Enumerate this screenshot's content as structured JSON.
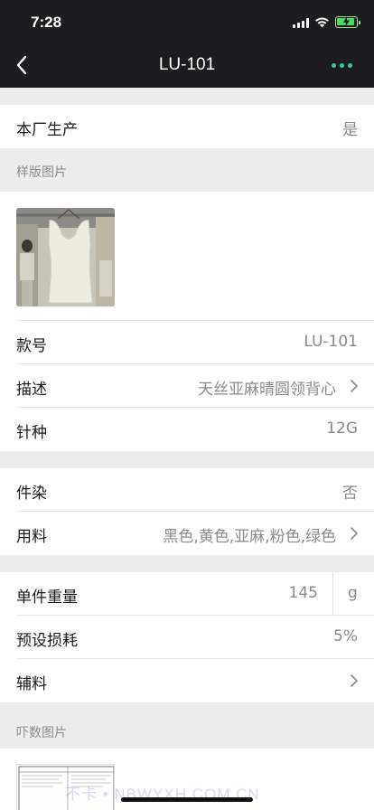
{
  "status": {
    "time": "7:28"
  },
  "nav": {
    "title": "LU-101"
  },
  "rows": {
    "in_house": {
      "label": "本厂生产",
      "value": "是"
    },
    "style_no": {
      "label": "款号",
      "value": "LU-101"
    },
    "desc": {
      "label": "描述",
      "value": "天丝亚麻晴圆领背心"
    },
    "gauge": {
      "label": "针种",
      "value": "12G"
    },
    "dyed": {
      "label": "件染",
      "value": "否"
    },
    "material": {
      "label": "用料",
      "value": "黑色,黄色,亚麻,粉色,绿色"
    },
    "weight": {
      "label": "单件重量",
      "value": "145",
      "unit": "g"
    },
    "loss": {
      "label": "预设损耗",
      "value": "5%"
    },
    "accessories": {
      "label": "辅料"
    }
  },
  "sections": {
    "sample_images": "样版图片",
    "spec_images": "吓数图片"
  },
  "watermark": "不卡 • NBWYXH.COM.CN",
  "colors": {
    "bar": "#1d1d1f",
    "accent": "#3ec6a2",
    "bg": "#ededed"
  }
}
